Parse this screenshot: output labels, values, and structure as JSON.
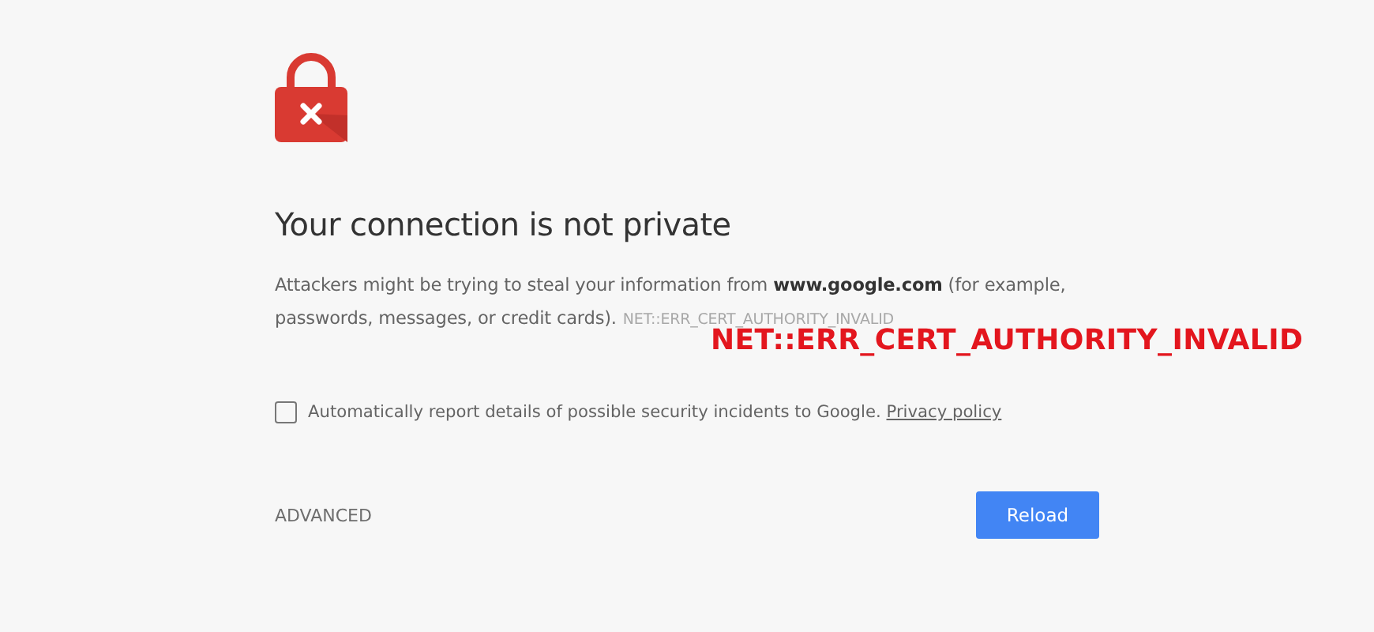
{
  "heading": "Your connection is not private",
  "message": "Attackers might be trying to steal your information from **www.google.com** (for example, passwords, messages, or credit cards).",
  "error_code": "NET::ERR_CERT_AUTHORITY_INVALID",
  "annotation": "NET::ERR_CERT_AUTHORITY_INVALID",
  "report": {
    "label": "Automatically report details of possible security incidents to Google.",
    "link": "Privacy policy",
    "checked": false
  },
  "advanced": "ADVANCED",
  "reload": "Reload"
}
